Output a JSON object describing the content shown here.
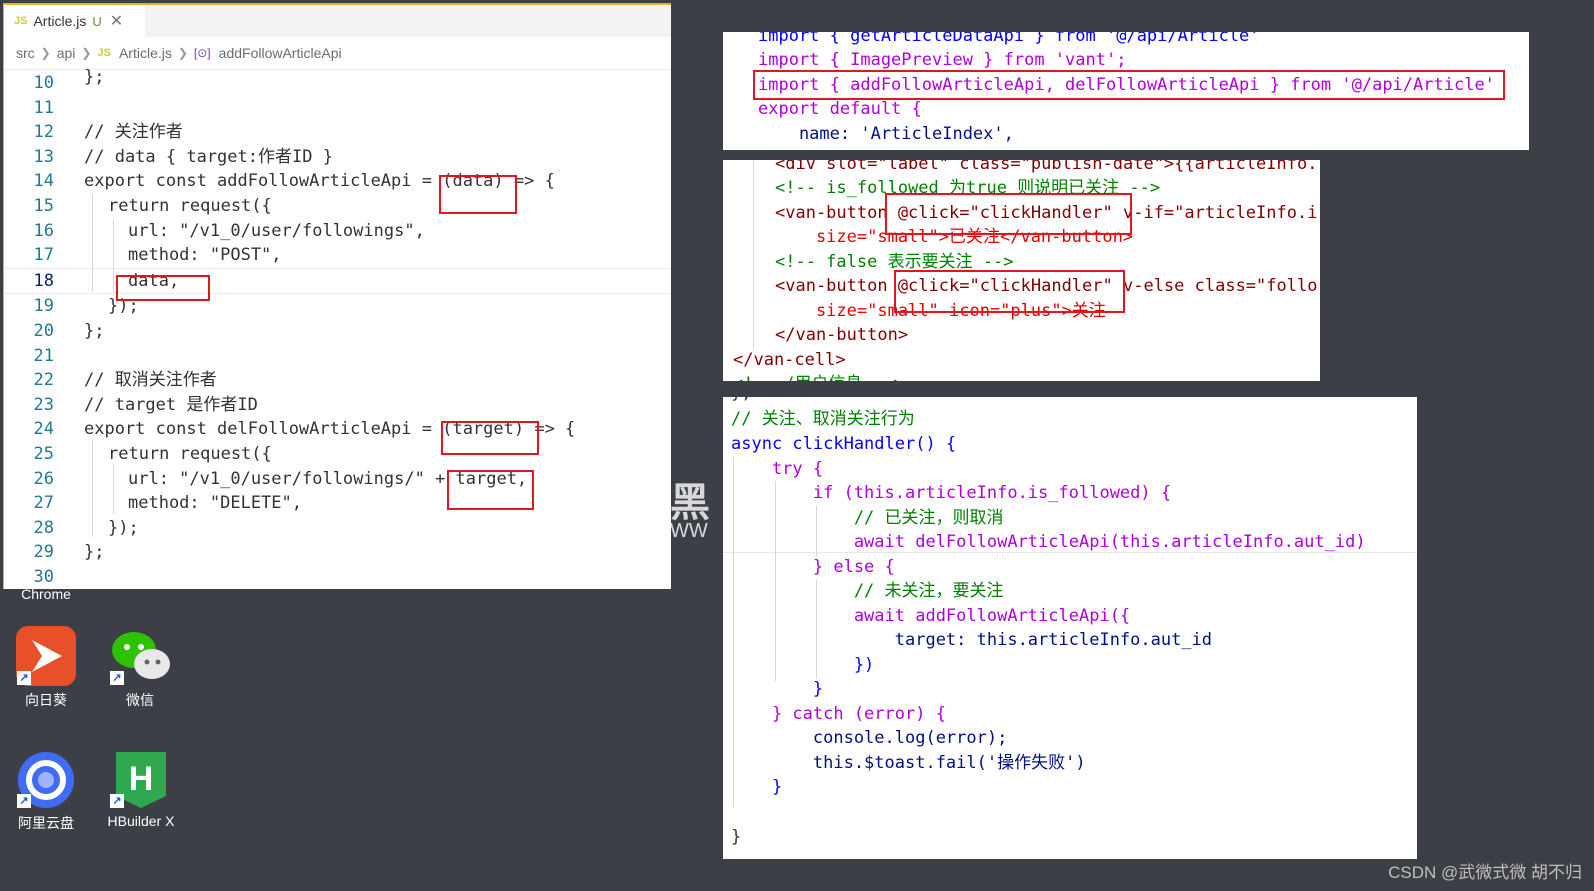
{
  "editor": {
    "tab": {
      "lang_badge": "JS",
      "filename": "Article.js",
      "status": "U",
      "close": "✕"
    },
    "breadcrumb": {
      "seg1": "src",
      "seg2": "api",
      "lang_badge": "JS",
      "seg3": "Article.js",
      "seg4_icon": "[⊙]",
      "seg4": "addFollowArticleApi"
    },
    "lines": [
      {
        "n": "10",
        "t": "};"
      },
      {
        "n": "11",
        "t": ""
      },
      {
        "n": "12",
        "t": "// 关注作者"
      },
      {
        "n": "13",
        "t": "// data { target:作者ID }"
      },
      {
        "n": "14",
        "t": "export const addFollowArticleApi = (data) => {"
      },
      {
        "n": "15",
        "t": "return request({"
      },
      {
        "n": "16",
        "t": "url: \"/v1_0/user/followings\","
      },
      {
        "n": "17",
        "t": "method: \"POST\","
      },
      {
        "n": "18",
        "t": "data,"
      },
      {
        "n": "19",
        "t": "});"
      },
      {
        "n": "20",
        "t": "};"
      },
      {
        "n": "21",
        "t": ""
      },
      {
        "n": "22",
        "t": "// 取消关注作者"
      },
      {
        "n": "23",
        "t": "// target 是作者ID"
      },
      {
        "n": "24",
        "t": "export const delFollowArticleApi = (target) => {"
      },
      {
        "n": "25",
        "t": "return request({"
      },
      {
        "n": "26",
        "t": "url: \"/v1_0/user/followings/\" + target,"
      },
      {
        "n": "27",
        "t": "method: \"DELETE\","
      },
      {
        "n": "28",
        "t": "});"
      },
      {
        "n": "29",
        "t": "};"
      },
      {
        "n": "30",
        "t": ""
      }
    ]
  },
  "desktop": {
    "chrome_label": "Chrome",
    "icons": [
      {
        "label": "向日葵",
        "icon": "sunflower-remote-icon",
        "color": "#e8502a"
      },
      {
        "label": "微信",
        "icon": "wechat-icon",
        "color": "#2dc100"
      },
      {
        "label": "阿里云盘",
        "icon": "aliyun-drive-icon",
        "color": "#3f6cf3"
      },
      {
        "label": "HBuilder X",
        "icon": "hbuilderx-icon",
        "color": "#2fa84f"
      }
    ],
    "watermark": "黑",
    "watermark_sub": "WW"
  },
  "snippet1": {
    "lines": [
      "import { getArticleDataApi } from '@/api/Article'",
      "import { ImagePreview } from 'vant';",
      "import { addFollowArticleApi, delFollowArticleApi } from '@/api/Article'",
      "export default {",
      "    name: 'ArticleIndex',"
    ]
  },
  "snippet2": {
    "lines": [
      "<div slot=\"label\" class=\"publish-date\">{{articleInfo.",
      "<!-- is_followed 为true 则说明已关注 -->",
      "<van-button @click=\"clickHandler\" v-if=\"articleInfo.i",
      "    size=\"small\">已关注</van-button>",
      "<!-- false 表示要关注 -->",
      "<van-button @click=\"clickHandler\" v-else class=\"follo",
      "    size=\"small\" icon=\"plus\">关注",
      "</van-button>",
      "</van-cell>",
      "<!-- /用户信息 -->"
    ]
  },
  "snippet3": {
    "lines": [
      "},",
      "// 关注、取消关注行为",
      "async clickHandler() {",
      "    try {",
      "        if (this.articleInfo.is_followed) {",
      "            // 已关注，则取消",
      "            await delFollowArticleApi(this.articleInfo.aut_id)",
      "        } else {",
      "            // 未关注，要关注",
      "            await addFollowArticleApi({",
      "                target: this.articleInfo.aut_id",
      "            })",
      "        }",
      "    } catch (error) {",
      "        console.log(error);",
      "        this.$toast.fail('操作失败')",
      "    }",
      "",
      "}"
    ]
  },
  "footer": "CSDN @武微式微  胡不归"
}
